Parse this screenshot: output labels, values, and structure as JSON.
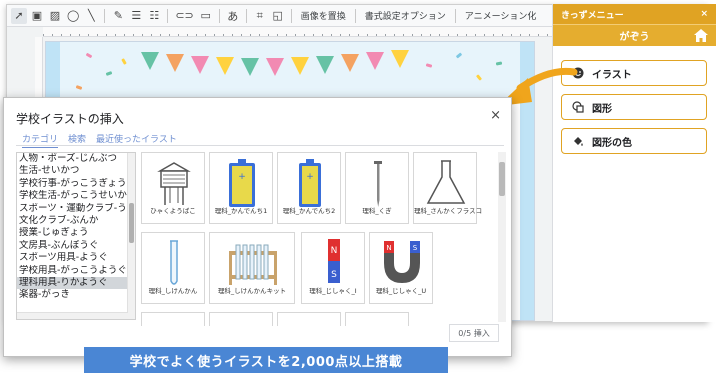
{
  "toolbar": {
    "bg_menu": "画像を置換",
    "format_options": "書式設定オプション",
    "animation": "アニメーション化",
    "text_btn": "あ"
  },
  "side_panel": {
    "title": "きっずメニュー",
    "subtitle": "がぞう",
    "buttons": [
      {
        "label": "イラスト",
        "icon": "smile-icon"
      },
      {
        "label": "図形",
        "icon": "shapes-icon"
      },
      {
        "label": "図形の色",
        "icon": "paint-bucket-icon"
      }
    ],
    "accent": "#e0a323"
  },
  "dialog": {
    "title": "学校イラストの挿入",
    "close": "×",
    "tabs": [
      "カテゴリ",
      "検索",
      "最近使ったイラスト"
    ],
    "categories": [
      "人物・ポーズ-じんぶつ",
      "生活-せいかつ",
      "学校行事-がっこうぎょうじ",
      "学校生活-がっこうせいかつ",
      "スポーツ・運動クラブ-うん",
      "文化クラブ-ぶんか",
      "授業-じゅぎょう",
      "文房具-ぶんぼうぐ",
      "スポーツ用具-ようぐ",
      "学校用具-がっこうようぐ",
      "理科用具-りかようぐ",
      "楽器-がっき"
    ],
    "selected_category_index": 10,
    "illustrations": [
      {
        "label": "ひゃくようばこ",
        "icon": "weather-box-icon"
      },
      {
        "label": "理科_かんでんち1",
        "icon": "battery-icon"
      },
      {
        "label": "理科_かんでんち2",
        "icon": "battery-icon"
      },
      {
        "label": "理科_くぎ",
        "icon": "nail-icon"
      },
      {
        "label": "理科_さんかくフラスコ",
        "icon": "flask-icon"
      },
      {
        "label": "理科_しけんかん",
        "icon": "test-tube-icon"
      },
      {
        "label": "理科_しけんかんキット",
        "icon": "test-tube-rack-icon"
      },
      {
        "label": "理科_じしゃく_I",
        "icon": "bar-magnet-icon"
      },
      {
        "label": "理科_じしゃく_U",
        "icon": "u-magnet-icon"
      }
    ],
    "insert_label": "0/5 挿入"
  },
  "banner": "学校でよく使うイラストを2,000点以上搭載",
  "colors": {
    "banner": "#4a86d4",
    "tab_text": "#6f8fd1",
    "battery_body": "#e8d94a",
    "battery_cap": "#3a6fd8"
  }
}
